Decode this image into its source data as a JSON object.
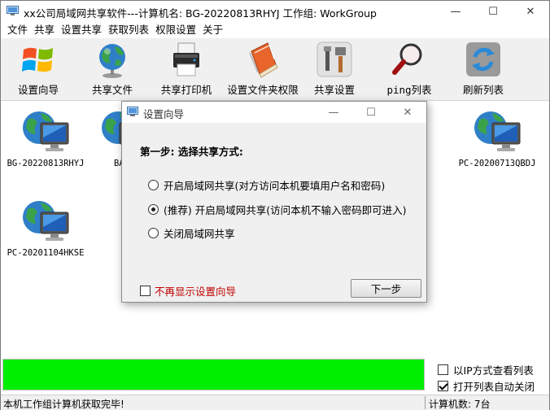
{
  "window": {
    "title": "xx公司局域网共享软件---计算机名: BG-20220813RHYJ  工作组: WorkGroup",
    "minimize_glyph": "—",
    "maximize_glyph": "☐",
    "close_glyph": "✕"
  },
  "menu": [
    "文件",
    "共享",
    "设置共享",
    "获取列表",
    "权限设置",
    "关于"
  ],
  "toolbar": [
    {
      "label": "设置向导",
      "icon": "windows-logo-icon"
    },
    {
      "label": "共享文件",
      "icon": "globe-icon"
    },
    {
      "label": "共享打印机",
      "icon": "printer-icon"
    },
    {
      "label": "设置文件夹权限",
      "icon": "book-icon"
    },
    {
      "label": "共享设置",
      "icon": "tools-icon"
    },
    {
      "label": "ping列表",
      "icon": "magnifier-icon"
    },
    {
      "label": "刷新列表",
      "icon": "refresh-icon"
    }
  ],
  "computers": [
    {
      "name": "BG-20220813RHYJ"
    },
    {
      "name": "BA"
    },
    {
      "name": "PC-20200713QBDJ"
    },
    {
      "name": "PC-20201104HKSE"
    }
  ],
  "dialog": {
    "title": "设置向导",
    "heading": "第一步: 选择共享方式:",
    "options": [
      {
        "label": "开启局域网共享(对方访问本机要填用户名和密码)",
        "selected": false
      },
      {
        "label": "(推荐) 开启局域网共享(访问本机不输入密码即可进入)",
        "selected": true
      },
      {
        "label": "关闭局域网共享",
        "selected": false
      }
    ],
    "dont_show_label": "不再显示设置向导",
    "next_label": "下一步"
  },
  "progress": {
    "value": 1.0,
    "color": "#00ef00"
  },
  "options_panel": {
    "view_by_ip": {
      "label": "以IP方式查看列表",
      "checked": false
    },
    "auto_close": {
      "label": "打开列表自动关闭",
      "checked": true
    }
  },
  "status": {
    "left": "本机工作组计算机获取完毕!",
    "right": "计算机数: 7台"
  }
}
